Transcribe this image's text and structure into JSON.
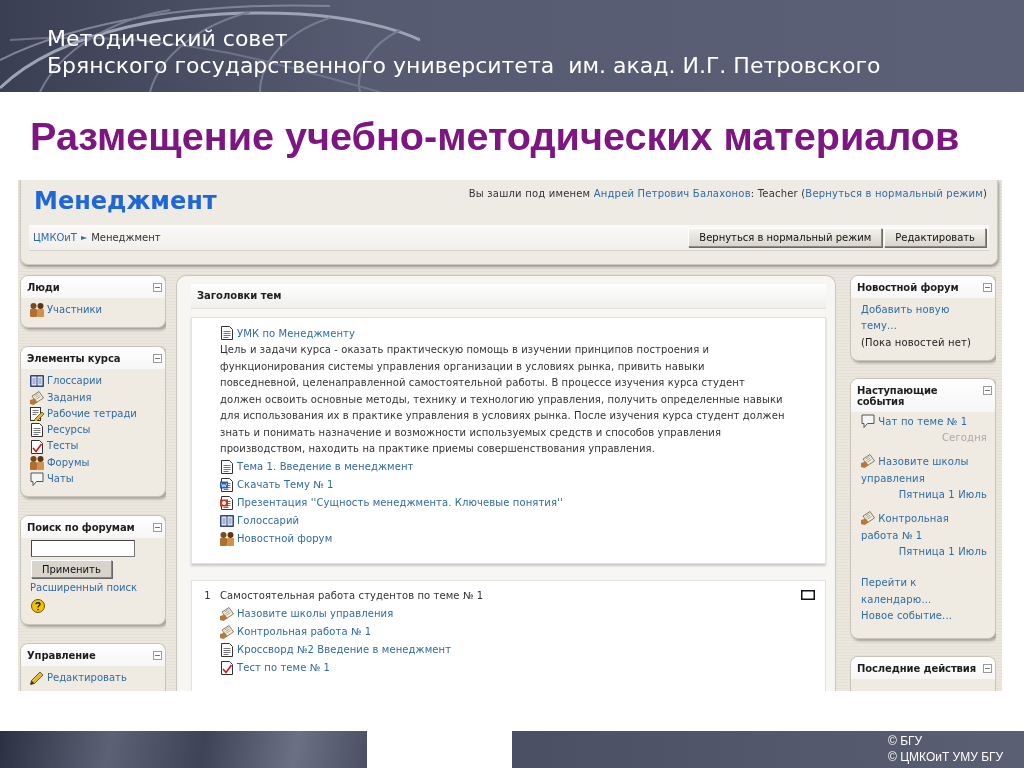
{
  "slide": {
    "header_lines": [
      "Методический совет",
      "Брянского государственного университета  им. акад. И.Г. Петровского"
    ],
    "title": "Размещение учебно-методических материалов",
    "footer_lines": [
      "© БГУ",
      "© ЦМКОиТ УМУ БГУ"
    ]
  },
  "course": {
    "title": "Менеджмент",
    "login": {
      "before": "Вы зашли под именем",
      "user": "Андрей Петрович Балахонов",
      "role": ": Teacher (",
      "mode_link": "Вернуться в нормальный режим",
      "after": ")"
    },
    "breadcrumb": [
      {
        "label": "ЦМКОиТ",
        "link": true
      },
      {
        "label": "Менеджмент",
        "link": false
      }
    ],
    "breadcrumb_separator": "►",
    "buttons": [
      "Вернуться в нормальный режим",
      "Редактировать"
    ]
  },
  "left_blocks": [
    {
      "title": "Люди",
      "kind": "links",
      "items": [
        {
          "label": "Участники",
          "kind": "participants"
        }
      ]
    },
    {
      "title": "Элементы курса",
      "kind": "links",
      "items": [
        {
          "label": "Глоссарии",
          "kind": "glossary"
        },
        {
          "label": "Задания",
          "kind": "assignment"
        },
        {
          "label": "Рабочие тетради",
          "kind": "workbook"
        },
        {
          "label": "Ресурсы",
          "kind": "resource"
        },
        {
          "label": "Тесты",
          "kind": "quiz"
        },
        {
          "label": "Форумы",
          "kind": "forum"
        },
        {
          "label": "Чаты",
          "kind": "chat"
        }
      ]
    },
    {
      "title": "Поиск по форумам",
      "kind": "search",
      "button": "Применить",
      "link": "Расширенный поиск"
    },
    {
      "title": "Управление",
      "kind": "links",
      "items": [
        {
          "label": "Редактировать",
          "kind": "edit"
        }
      ]
    }
  ],
  "topics": {
    "title": "Заголовки тем",
    "sections": [
      {
        "marker_box": false,
        "items": [
          {
            "kind": "resource",
            "label": "УМК по Менеджменту"
          },
          {
            "kind": "text",
            "text": "Цель и задачи курса - оказать практическую помощь в изучении принципов построения и функционирования системы управления организации в условиях рынка, привить навыки повседневной, целенаправленной самостоятельной работы. В процессе изучения курса студент должен освоить основные методы, технику и технологию управления, получить определенные навыки для использования их в практике управления в условиях рынка. После изучения курса студент должен знать и понимать назначение и возможности используемых средств и способов управления производством, находить на практике приемы совершенствования управления."
          },
          {
            "kind": "resource",
            "label": "Тема 1. Введение в менеджмент"
          },
          {
            "kind": "word",
            "label": "Скачать Тему № 1"
          },
          {
            "kind": "powerpoint",
            "label": "Презентация ''Сущность менеджмента. Ключевые понятия''"
          },
          {
            "kind": "glossary",
            "label": "Голоссарий"
          },
          {
            "kind": "forum",
            "label": "Новостной форум"
          }
        ]
      },
      {
        "number": "1",
        "summary": "Самостоятельная работа студентов по теме № 1",
        "marker_box": true,
        "items": [
          {
            "kind": "assignment",
            "label": "Назовите школы управления"
          },
          {
            "kind": "assignment",
            "label": "Контрольная работа № 1"
          },
          {
            "kind": "resource",
            "label": "Кроссворд №2 Введение в менеджмент"
          },
          {
            "kind": "quiz",
            "label": "Тест по теме № 1"
          }
        ]
      }
    ]
  },
  "right_blocks": [
    {
      "title": "Новостной форум",
      "kind": "news",
      "link": "Добавить новую тему...",
      "note": "(Пока новостей нет)"
    },
    {
      "title": "Наступающие события",
      "kind": "events",
      "events": [
        {
          "title": "Чат по теме № 1",
          "kind": "chat",
          "date": "Сегодня",
          "date_link": false
        },
        {
          "title": "Назовите школы управления",
          "kind": "assignment",
          "date": "Пятница 1 Июль",
          "date_link": true
        },
        {
          "title": "Контрольная работа № 1",
          "kind": "assignment",
          "date": "Пятница 1 Июль",
          "date_link": true
        }
      ],
      "links": [
        "Перейти к календарю...",
        "Новое событие..."
      ]
    },
    {
      "title": "Последние действия",
      "kind": "links"
    }
  ]
}
